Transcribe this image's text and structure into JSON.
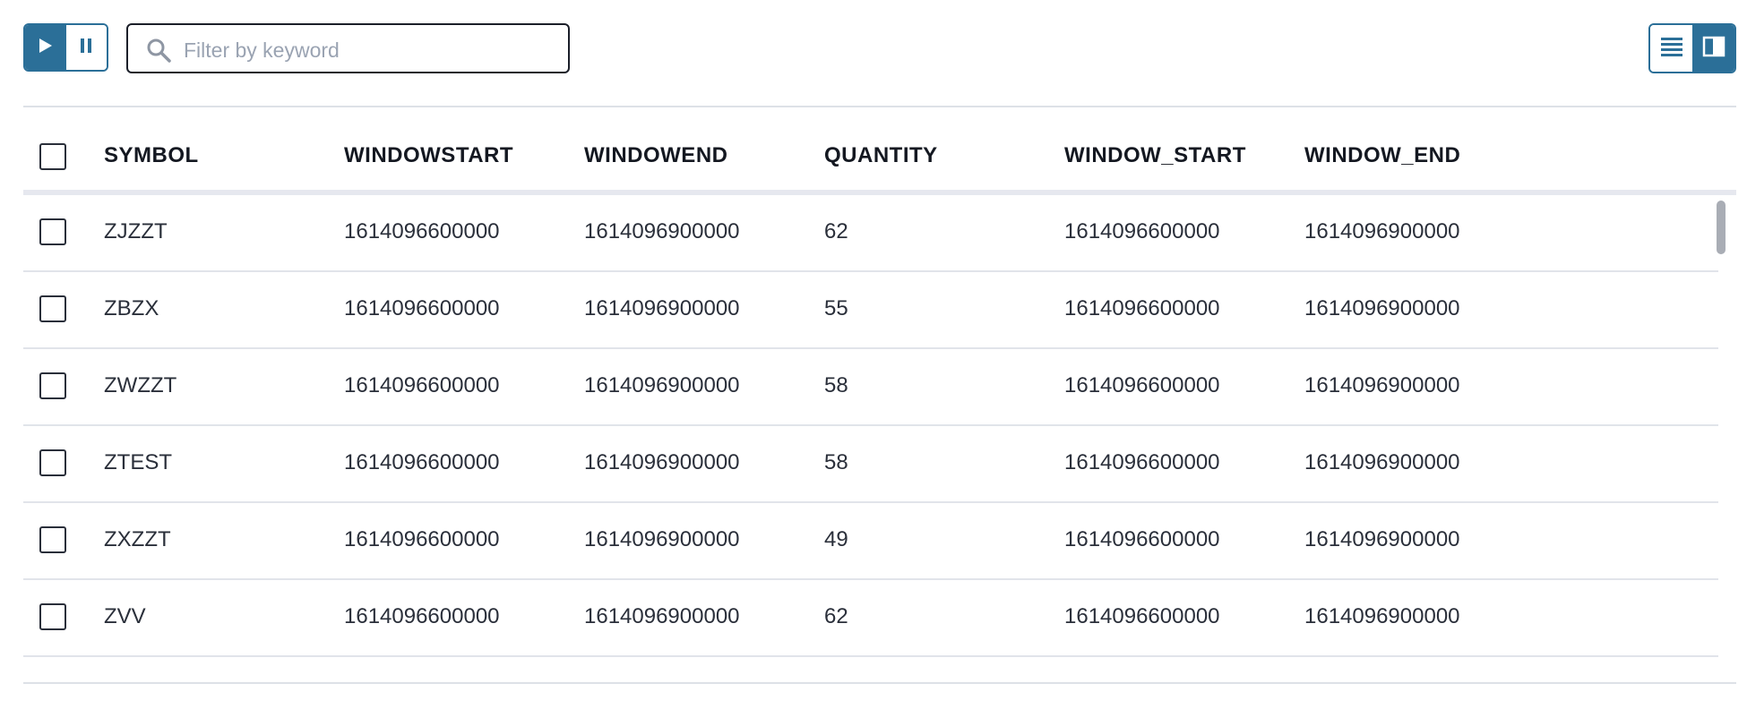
{
  "toolbar": {
    "play_icon": "play-icon",
    "pause_icon": "pause-icon",
    "search": {
      "placeholder": "Filter by keyword",
      "value": ""
    },
    "view_icons": [
      "list-view-icon",
      "split-view-icon"
    ],
    "accent_color": "#2b6f98"
  },
  "table": {
    "columns": [
      "SYMBOL",
      "WINDOWSTART",
      "WINDOWEND",
      "QUANTITY",
      "WINDOW_START",
      "WINDOW_END"
    ],
    "rows": [
      [
        "ZJZZT",
        "1614096600000",
        "1614096900000",
        "62",
        "1614096600000",
        "1614096900000"
      ],
      [
        "ZBZX",
        "1614096600000",
        "1614096900000",
        "55",
        "1614096600000",
        "1614096900000"
      ],
      [
        "ZWZZT",
        "1614096600000",
        "1614096900000",
        "58",
        "1614096600000",
        "1614096900000"
      ],
      [
        "ZTEST",
        "1614096600000",
        "1614096900000",
        "58",
        "1614096600000",
        "1614096900000"
      ],
      [
        "ZXZZT",
        "1614096600000",
        "1614096900000",
        "49",
        "1614096600000",
        "1614096900000"
      ],
      [
        "ZVV",
        "1614096600000",
        "1614096900000",
        "62",
        "1614096600000",
        "1614096900000"
      ]
    ]
  }
}
